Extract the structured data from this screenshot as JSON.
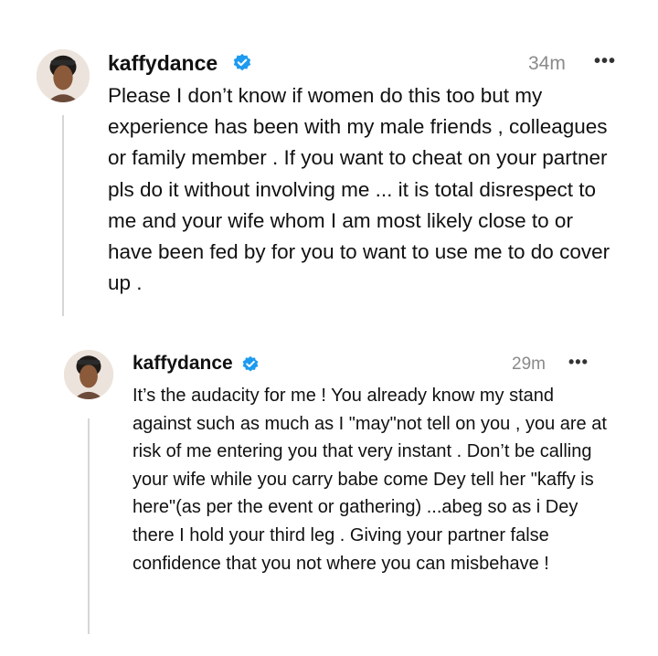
{
  "posts": [
    {
      "username": "kaffydance",
      "time": "34m",
      "more": "•••",
      "text": "Please I don’t know if women do this too but my experience has been with my male friends , colleagues or family member . If you want to cheat on your partner pls do it without involving me ... it is total disrespect to me and your wife whom I am most likely close to or have been fed by for you to want to use me to do cover up ."
    },
    {
      "username": "kaffydance",
      "time": "29m",
      "more": "•••",
      "text": "It’s the audacity for me ! You already know my stand against such as much as I \"may\"not tell on you , you are at risk of me entering you that very instant . Don’t be calling your wife while you carry babe come Dey tell her \"kaffy is here\"(as per the event or gathering) ...abeg so as i Dey there I hold your third leg . Giving your partner false confidence that you not where you can misbehave !"
    }
  ],
  "icons": {
    "verified": "verified-badge-icon",
    "more": "more-options-icon"
  },
  "colors": {
    "verified": "#1d9bf0",
    "time": "#8a8a8a",
    "thread_line": "#d6d6d6",
    "text": "#111111"
  }
}
